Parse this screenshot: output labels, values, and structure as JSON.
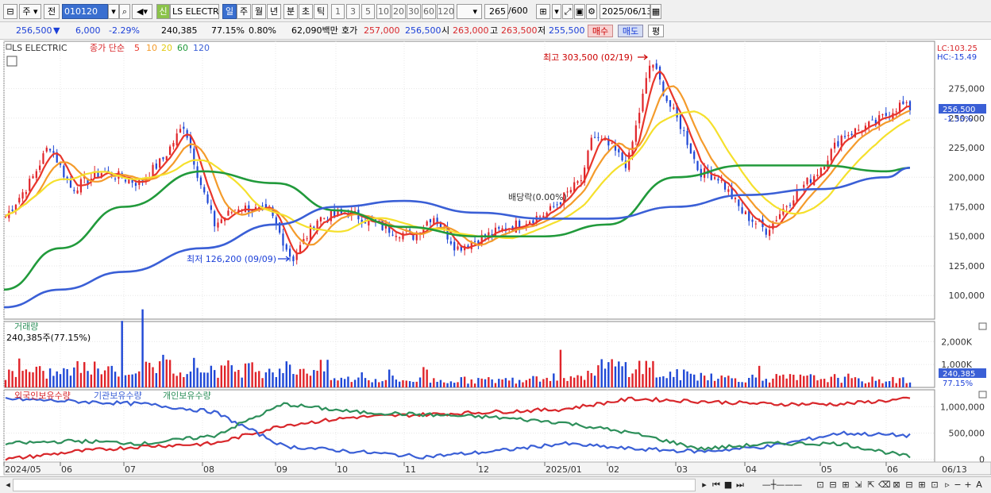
{
  "toolbar": {
    "type_label": "주",
    "prev_label": "전",
    "code": "010120",
    "shin": "신",
    "name": "LS ELECTRI",
    "periods": [
      "일",
      "주",
      "월",
      "년",
      "분",
      "초",
      "틱"
    ],
    "nums": [
      "1",
      "3",
      "5",
      "10",
      "20",
      "30",
      "60",
      "120"
    ],
    "count": "265",
    "count_total": "/600",
    "date": "2025/06/13"
  },
  "quote": {
    "price": "256,500",
    "arrow": "▼",
    "change": "6,000",
    "rate": "-2.29%",
    "volume": "240,385",
    "vol_ratio": "77.15%",
    "turnover": "0.80%",
    "amount": "62,090백만",
    "hoga_label": "호가",
    "hoga_ask": "257,000",
    "hoga_bid": "256,500",
    "open_label": "시",
    "open": "263,000",
    "high_label": "고",
    "high": "263,500",
    "low_label": "저",
    "low": "255,500",
    "buy": "매수",
    "sell": "매도",
    "eval": "평"
  },
  "price_pane": {
    "legend_name": "LS ELECTRIC",
    "legend_prefix": "종가 단순",
    "ma_labels": [
      "5",
      "10",
      "20",
      "60",
      "120"
    ],
    "ma_colors": [
      "#e8362b",
      "#f49b2b",
      "#f5e02c",
      "#219a3b",
      "#3a5fd6"
    ],
    "lc": "LC:103.25",
    "hc": "HC:-15.49",
    "high_note": "최고 303,500 (02/19)",
    "low_note": "최저 126,200 (09/09)",
    "dividend_note": "배당락(0.00%)",
    "current_price": "256,500",
    "current_rate": "-1.35%",
    "y_ticks": [
      "275,000",
      "250,000",
      "225,000",
      "200,000",
      "175,000",
      "150,000",
      "125,000",
      "100,000"
    ]
  },
  "volume_pane": {
    "title": "거래량",
    "value": "240,385주(77.15%)",
    "y_ticks": [
      "2,000K",
      "1,000K"
    ],
    "current": "240,385",
    "current_ratio": "77.15%"
  },
  "holdings_pane": {
    "legend": [
      "외국인보유수량",
      "기관보유수량",
      "개인보유수량"
    ],
    "colors": [
      "#d8272b",
      "#3a5fd6",
      "#2d8f5a"
    ],
    "y_ticks": [
      "1,000,000",
      "500,000",
      "0"
    ]
  },
  "x_axis": [
    "2024/05",
    "06",
    "07",
    "08",
    "09",
    "10",
    "11",
    "12",
    "2025/01",
    "02",
    "03",
    "04",
    "05",
    "06",
    "06/13"
  ],
  "chart_data": [
    {
      "type": "line",
      "title": "LS ELECTRIC 일봉 (종가 단순 이동평균 5·10·20·60·120)",
      "xlabel": "",
      "ylabel": "",
      "x": [
        "2024/05",
        "06",
        "07",
        "08",
        "09",
        "10",
        "11",
        "12",
        "2025/01",
        "02",
        "03",
        "04",
        "05",
        "06",
        "06/13"
      ],
      "ylim": [
        80000,
        315000
      ],
      "series": [
        {
          "name": "종가",
          "values": [
            165000,
            205000,
            190000,
            205000,
            145000,
            160000,
            150000,
            140000,
            170000,
            260000,
            200000,
            165000,
            215000,
            245000,
            256500
          ]
        },
        {
          "name": "120",
          "values": [
            90000,
            105000,
            120000,
            140000,
            160000,
            175000,
            180000,
            170000,
            165000,
            165000,
            175000,
            185000,
            190000,
            200000,
            208000
          ]
        },
        {
          "name": "60",
          "values": [
            105000,
            140000,
            175000,
            205000,
            195000,
            172000,
            158000,
            150000,
            150000,
            160000,
            200000,
            210000,
            210000,
            205000,
            208000
          ]
        }
      ],
      "annotations": [
        "최고 303,500 (02/19)",
        "최저 126,200 (09/09)"
      ]
    },
    {
      "type": "bar",
      "title": "거래량",
      "categories": [
        "2024/05",
        "06",
        "07",
        "08",
        "09",
        "10",
        "11",
        "12",
        "2025/01",
        "02",
        "03",
        "04",
        "05",
        "06"
      ],
      "values": [
        700000,
        900000,
        1000000,
        900000,
        900000,
        400000,
        350000,
        350000,
        550000,
        1000000,
        600000,
        450000,
        450000,
        350000
      ],
      "ylabel": "",
      "ylim": [
        0,
        2600000
      ]
    },
    {
      "type": "line",
      "title": "보유수량",
      "x": [
        "2024/05",
        "06",
        "07",
        "08",
        "09",
        "10",
        "11",
        "12",
        "2025/01",
        "02",
        "03",
        "04",
        "05",
        "06"
      ],
      "ylim": [
        -50000,
        1200000
      ],
      "series": [
        {
          "name": "외국인보유수량",
          "values": [
            0,
            150000,
            250000,
            300000,
            650000,
            800000,
            850000,
            900000,
            950000,
            1150000,
            1100000,
            1050000,
            1050000,
            1150000
          ]
        },
        {
          "name": "기관보유수량",
          "values": [
            1150000,
            1100000,
            1050000,
            900000,
            250000,
            150000,
            50000,
            150000,
            300000,
            200000,
            150000,
            250000,
            500000,
            450000
          ]
        },
        {
          "name": "개인보유수량",
          "values": [
            300000,
            350000,
            300000,
            450000,
            1050000,
            900000,
            850000,
            800000,
            700000,
            500000,
            200000,
            300000,
            300000,
            50000
          ]
        }
      ]
    }
  ]
}
